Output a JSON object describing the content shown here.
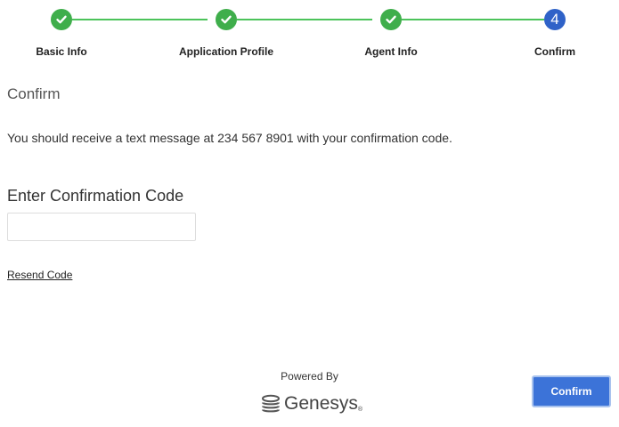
{
  "stepper": {
    "steps": [
      {
        "label": "Basic Info",
        "status": "complete"
      },
      {
        "label": "Application Profile",
        "status": "complete"
      },
      {
        "label": "Agent Info",
        "status": "complete"
      },
      {
        "label": "Confirm",
        "status": "current",
        "number": "4"
      }
    ],
    "complete_color": "#3fae4b",
    "line_color": "#4cc35b",
    "current_color": "#2f62c8"
  },
  "main": {
    "section_title": "Confirm",
    "message": "You should receive a text message at 234 567 8901 with your confirmation code.",
    "code_label": "Enter Confirmation Code",
    "code_value": "",
    "code_placeholder": "",
    "resend_label": "Resend Code"
  },
  "footer": {
    "powered_by": "Powered By",
    "brand_name": "Genesys",
    "brand_tm": "®",
    "confirm_label": "Confirm",
    "confirm_color": "#3c73d8"
  }
}
